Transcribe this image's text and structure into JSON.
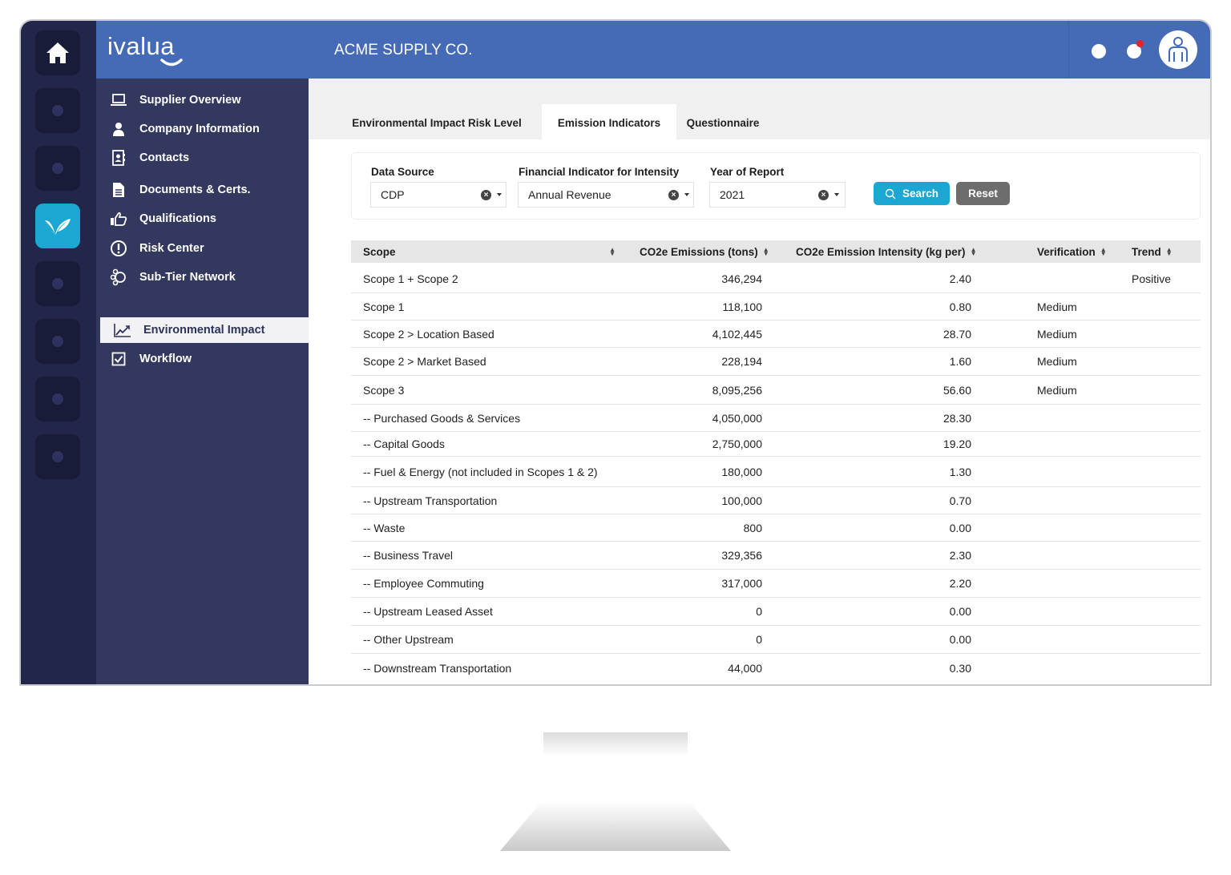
{
  "app": {
    "logo": "ivalua",
    "company": "ACME SUPPLY CO."
  },
  "topbar": {
    "icons": [
      "notification-dot-icon",
      "alert-dot-icon",
      "user-avatar-icon"
    ],
    "badge_color": "#e8202a"
  },
  "rail": {
    "items": [
      "home-icon",
      "nav-icon",
      "nav-icon",
      "leaf-check-icon",
      "nav-icon",
      "nav-icon",
      "nav-icon",
      "nav-icon"
    ],
    "active_index": 3
  },
  "sidebar": {
    "items": [
      {
        "label": "Supplier Overview",
        "icon": "laptop-icon"
      },
      {
        "label": "Company Information",
        "icon": "person-icon"
      },
      {
        "label": "Contacts",
        "icon": "contact-book-icon"
      },
      {
        "label": "Documents & Certs.",
        "icon": "document-icon"
      },
      {
        "label": "Qualifications",
        "icon": "thumbs-up-icon"
      },
      {
        "label": "Risk Center",
        "icon": "alert-circle-icon"
      },
      {
        "label": "Sub-Tier Network",
        "icon": "network-icon"
      },
      {
        "label": "Environmental Impact",
        "icon": "line-chart-icon"
      },
      {
        "label": "Workflow",
        "icon": "checkbox-icon"
      }
    ],
    "active_index": 7
  },
  "tabs": [
    {
      "label": "Environmental Impact Risk Level"
    },
    {
      "label": "Emission Indicators"
    },
    {
      "label": "Questionnaire"
    }
  ],
  "active_tab": 1,
  "filters": {
    "data_source": {
      "label": "Data Source",
      "value": "CDP"
    },
    "financial_indicator": {
      "label": "Financial Indicator for Intensity",
      "value": "Annual Revenue"
    },
    "year": {
      "label": "Year of Report",
      "value": "2021"
    },
    "search_label": "Search",
    "reset_label": "Reset"
  },
  "table": {
    "columns": [
      "Scope",
      "CO2e Emissions (tons)",
      "CO2e Emission Intensity (kg per)",
      "Verification",
      "Trend"
    ],
    "rows": [
      {
        "scope": "Scope 1 + Scope 2",
        "emissions": "346,294",
        "intensity": "2.40",
        "verification": "",
        "trend": "Positive"
      },
      {
        "scope": "Scope 1",
        "emissions": "118,100",
        "intensity": "0.80",
        "verification": "Medium",
        "trend": ""
      },
      {
        "scope": "Scope 2 > Location Based",
        "emissions": "4,102,445",
        "intensity": "28.70",
        "verification": "Medium",
        "trend": ""
      },
      {
        "scope": "Scope 2 > Market Based",
        "emissions": "228,194",
        "intensity": "1.60",
        "verification": "Medium",
        "trend": ""
      },
      {
        "scope": "Scope 3",
        "emissions": "8,095,256",
        "intensity": "56.60",
        "verification": "Medium",
        "trend": ""
      },
      {
        "scope": "-- Purchased Goods & Services",
        "emissions": "4,050,000",
        "intensity": "28.30",
        "verification": "",
        "trend": ""
      },
      {
        "scope": "-- Capital Goods",
        "emissions": "2,750,000",
        "intensity": "19.20",
        "verification": "",
        "trend": ""
      },
      {
        "scope": "-- Fuel & Energy (not included in Scopes 1 & 2)",
        "emissions": "180,000",
        "intensity": "1.30",
        "verification": "",
        "trend": ""
      },
      {
        "scope": "-- Upstream Transportation",
        "emissions": "100,000",
        "intensity": "0.70",
        "verification": "",
        "trend": ""
      },
      {
        "scope": "-- Waste",
        "emissions": "800",
        "intensity": "0.00",
        "verification": "",
        "trend": ""
      },
      {
        "scope": "-- Business Travel",
        "emissions": "329,356",
        "intensity": "2.30",
        "verification": "",
        "trend": ""
      },
      {
        "scope": "-- Employee Commuting",
        "emissions": "317,000",
        "intensity": "2.20",
        "verification": "",
        "trend": ""
      },
      {
        "scope": "-- Upstream Leased Asset",
        "emissions": "0",
        "intensity": "0.00",
        "verification": "",
        "trend": ""
      },
      {
        "scope": "-- Other Upstream",
        "emissions": "0",
        "intensity": "0.00",
        "verification": "",
        "trend": ""
      },
      {
        "scope": "-- Downstream Transportation",
        "emissions": "44,000",
        "intensity": "0.30",
        "verification": "",
        "trend": ""
      }
    ]
  },
  "colors": {
    "topbar": "#456bb6",
    "rail": "#22264a",
    "sidebar": "#33385e",
    "accent": "#1ba7d1",
    "reset": "#6d6d6d"
  }
}
